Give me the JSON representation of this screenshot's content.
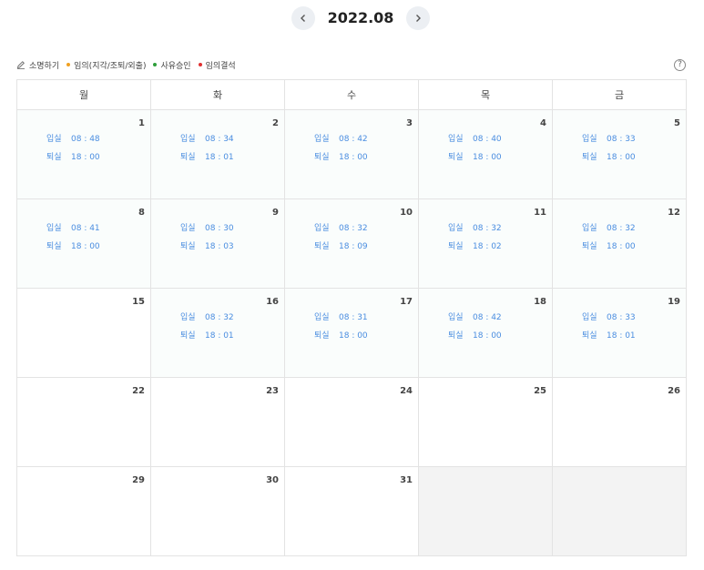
{
  "header": {
    "title": "2022.08",
    "prev_label": "‹",
    "next_label": "›"
  },
  "legend": {
    "explain_label": "소명하기",
    "items": [
      {
        "label": "임의(지각/조퇴/외출)",
        "color": "#f0a020"
      },
      {
        "label": "사유승인",
        "color": "#2e9e3a"
      },
      {
        "label": "임의결석",
        "color": "#e03030"
      }
    ],
    "help_label": "?"
  },
  "calendar": {
    "weekdays": [
      "월",
      "화",
      "수",
      "목",
      "금"
    ],
    "in_label": "입실",
    "out_label": "퇴실",
    "weeks": [
      [
        {
          "day": "1",
          "in": "08 : 48",
          "out": "18 : 00"
        },
        {
          "day": "2",
          "in": "08 : 34",
          "out": "18 : 01"
        },
        {
          "day": "3",
          "in": "08 : 42",
          "out": "18 : 00"
        },
        {
          "day": "4",
          "in": "08 : 40",
          "out": "18 : 00"
        },
        {
          "day": "5",
          "in": "08 : 33",
          "out": "18 : 00"
        }
      ],
      [
        {
          "day": "8",
          "in": "08 : 41",
          "out": "18 : 00"
        },
        {
          "day": "9",
          "in": "08 : 30",
          "out": "18 : 03"
        },
        {
          "day": "10",
          "in": "08 : 32",
          "out": "18 : 09"
        },
        {
          "day": "11",
          "in": "08 : 32",
          "out": "18 : 02"
        },
        {
          "day": "12",
          "in": "08 : 32",
          "out": "18 : 00"
        }
      ],
      [
        {
          "day": "15"
        },
        {
          "day": "16",
          "in": "08 : 32",
          "out": "18 : 01"
        },
        {
          "day": "17",
          "in": "08 : 31",
          "out": "18 : 00"
        },
        {
          "day": "18",
          "in": "08 : 42",
          "out": "18 : 00"
        },
        {
          "day": "19",
          "in": "08 : 33",
          "out": "18 : 01"
        }
      ],
      [
        {
          "day": "22"
        },
        {
          "day": "23"
        },
        {
          "day": "24"
        },
        {
          "day": "25"
        },
        {
          "day": "26"
        }
      ],
      [
        {
          "day": "29"
        },
        {
          "day": "30"
        },
        {
          "day": "31"
        },
        {
          "day": ""
        },
        {
          "day": ""
        }
      ]
    ]
  }
}
